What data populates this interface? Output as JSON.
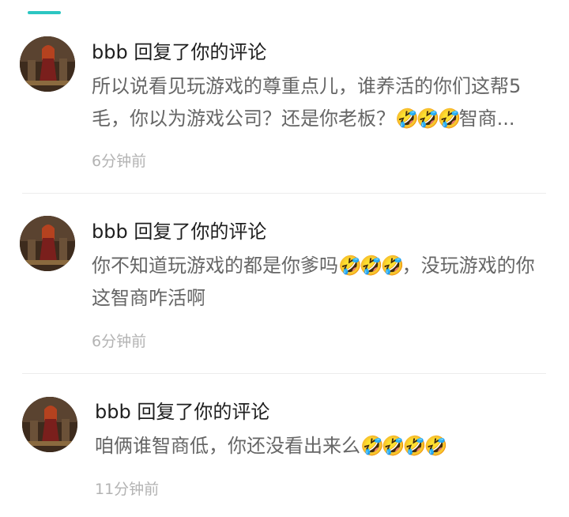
{
  "comments": [
    {
      "username": "bbb",
      "action": "回复了你的评论",
      "text": "所以说看见玩游戏的尊重点儿，谁养活的你们这帮5毛，你以为游戏公司？还是你老板？",
      "emoji": "🤣🤣🤣",
      "text_after": "智商...",
      "time": "6分钟前"
    },
    {
      "username": "bbb",
      "action": "回复了你的评论",
      "text": "你不知道玩游戏的都是你爹吗",
      "emoji": "🤣🤣🤣",
      "text_after": "，没玩游戏的你这智商咋活啊",
      "time": "6分钟前"
    },
    {
      "username": "bbb",
      "action": "回复了你的评论",
      "text": "咱俩谁智商低，你还没看出来么",
      "emoji": "🤣🤣🤣🤣",
      "text_after": "",
      "time": "11分钟前"
    }
  ]
}
